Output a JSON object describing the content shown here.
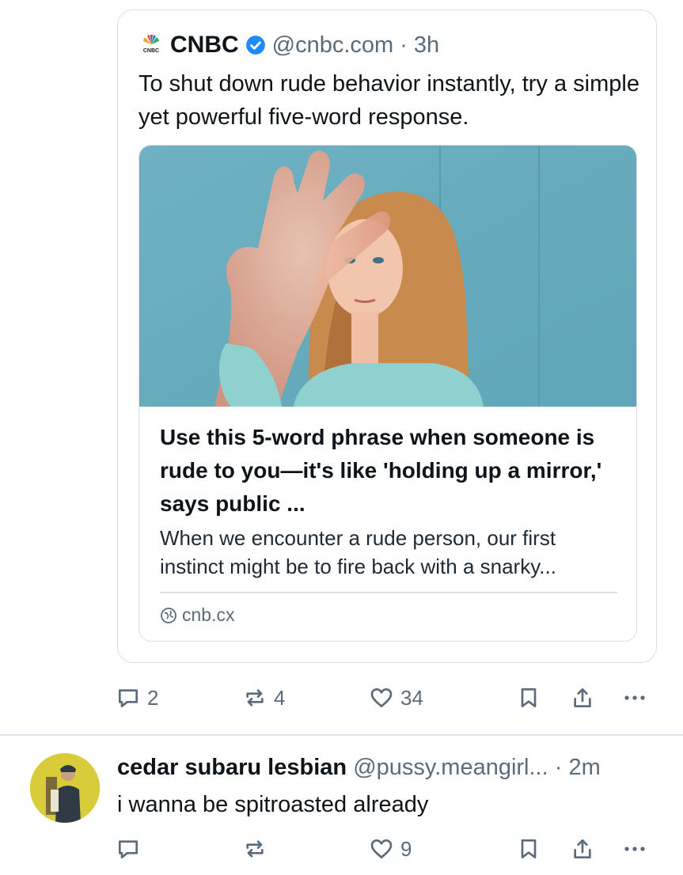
{
  "quoted_post": {
    "author_name": "CNBC",
    "handle": "@cnbc.com",
    "separator": "·",
    "time": "3h",
    "text": "To shut down rude behavior instantly, try a simple yet powerful five-word response.",
    "avatar_icon": "cnbc-peacock-logo",
    "link_card": {
      "title": "Use this 5-word phrase when someone is rude to you—it's like 'holding up a mirror,' says public ...",
      "description": "When we encounter a rude person, our first instinct might be to fire back with a snarky...",
      "domain": "cnb.cx",
      "image_description_icon": "woman-raising-hand-photo"
    }
  },
  "post_actions": {
    "replies": "2",
    "reposts": "4",
    "likes": "34"
  },
  "reply_post": {
    "author_name": "cedar subaru lesbian",
    "handle": "@pussy.meangirl...",
    "separator": "·",
    "time": "2m",
    "text": "i wanna be spitroasted already"
  },
  "reply_actions": {
    "replies": "",
    "reposts": "",
    "likes": "9"
  },
  "colors": {
    "text": "#0f1419",
    "muted": "#5b6b7b",
    "border": "#d9dfe5",
    "verified": "#1d8cf8"
  }
}
